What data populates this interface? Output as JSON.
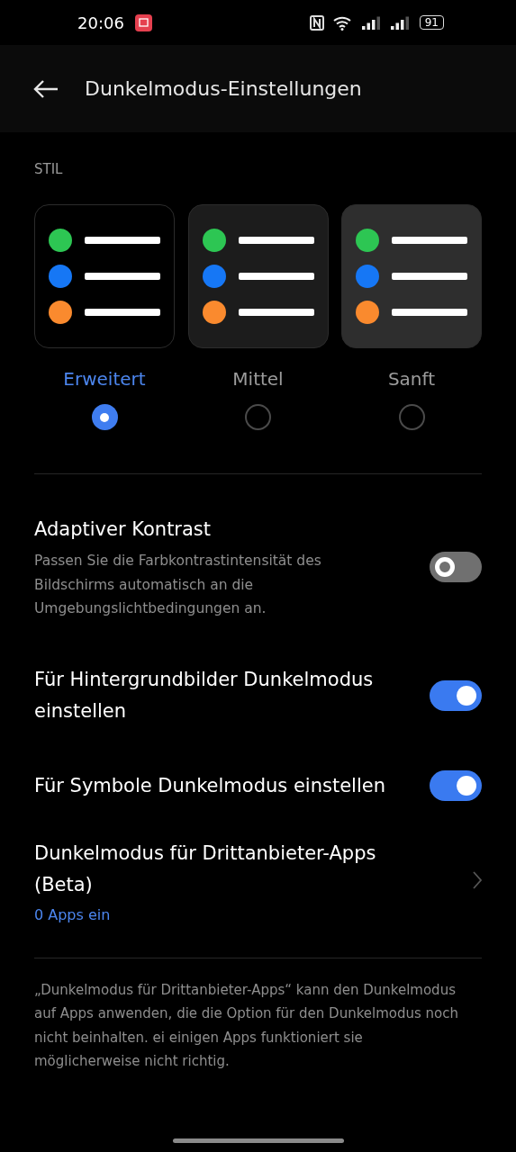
{
  "status_bar": {
    "time": "20:06",
    "battery": "91"
  },
  "header": {
    "title": "Dunkelmodus-Einstellungen"
  },
  "style_section": {
    "heading": "STIL",
    "options": [
      {
        "label": "Erweitert",
        "selected": true,
        "color": "#000000"
      },
      {
        "label": "Mittel",
        "selected": false,
        "color": "#1c1c1c"
      },
      {
        "label": "Sanft",
        "selected": false,
        "color": "#2e2e2e"
      }
    ]
  },
  "settings": [
    {
      "kind": "toggle",
      "title": "Adaptiver Kontrast",
      "description": "Passen Sie die Farbkontrastintensität des Bildschirms automatisch an die Umgebungslichtbedingungen an.",
      "on": false
    },
    {
      "kind": "toggle",
      "title": "Für Hintergrundbilder Dunkelmodus einstellen",
      "on": true
    },
    {
      "kind": "toggle",
      "title": "Für Symbole Dunkelmodus einstellen",
      "on": true
    },
    {
      "kind": "link",
      "title": "Dunkelmodus für Drittanbieter-Apps (Beta)",
      "subtitle": "0 Apps ein"
    }
  ],
  "footer_note": "„Dunkelmodus für Drittanbieter-Apps“ kann den Dunkelmodus auf Apps anwenden, die die Option für den Dunkelmodus noch nicht beinhalten. ei einigen Apps funktioniert sie möglicherweise nicht richtig."
}
